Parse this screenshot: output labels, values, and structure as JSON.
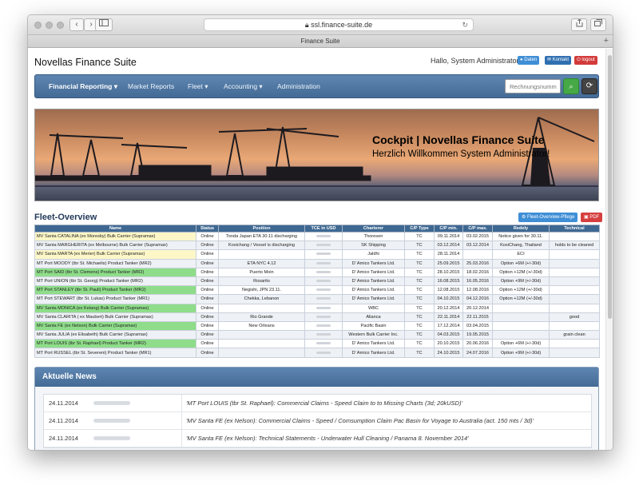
{
  "browser": {
    "url": "ssl.finance-suite.de",
    "tab_title": "Finance Suite",
    "back_label": "‹",
    "forward_label": "›",
    "reload_label": "↻",
    "new_tab_label": "+"
  },
  "header": {
    "brand": "Novellas Finance Suite",
    "greeting": "Hallo, System Administrator",
    "buttons": {
      "daten": "Daten",
      "kontakt": "Kontakt",
      "logout": "logout"
    }
  },
  "nav": {
    "items": [
      "Financial Reporting ▾",
      "Market Reports",
      "Fleet ▾",
      "Accounting ▾",
      "Administration"
    ],
    "search_placeholder": "Rechnungsnumm",
    "search_icon": "search-icon",
    "reset_icon": "refresh-icon"
  },
  "hero": {
    "title": "Cockpit | Novellas Finance Suite",
    "subtitle": "Herzlich Willkommen System Administrator!"
  },
  "fleet": {
    "title": "Fleet-Overview",
    "pflege_label": "Fleet-Overview-Pflege",
    "pdf_label": "PDF",
    "columns": [
      "Name",
      "Status",
      "Position",
      "TCE in USD",
      "Charterer",
      "C/P Type",
      "C/P min.",
      "C/P max.",
      "Redely",
      "Technical"
    ],
    "rows": [
      {
        "name": "MV Santa CATALINA (ex Moresby) Bulk Carrier (Supramax)",
        "status": "Online",
        "position": "Tonda Japan ETA 30.11 discharging",
        "charterer": "Thoresen",
        "type": "TC",
        "min": "09.11.2014",
        "max": "03.02.2015",
        "redely": "Notice given for 30.11.",
        "technical": "",
        "color": "yellow"
      },
      {
        "name": "MV Santa MARGHERITA (ex Melbourne) Bulk Carrier (Supramax)",
        "status": "Online",
        "position": "Kosichang / Vessel is discharging",
        "charterer": "SK Shipping",
        "type": "TC",
        "min": "03.12.2014",
        "max": "03.12.2014",
        "redely": "KosiChang, Thailand",
        "technical": "holds to be cleaned",
        "color": "yellow"
      },
      {
        "name": "MV Santa MARTA (ex Merier) Bulk Carrier (Supramax)",
        "status": "Online",
        "position": "",
        "charterer": "Jaldhi",
        "type": "TC",
        "min": "28.11.2014",
        "max": "",
        "redely": "ECI",
        "technical": "",
        "color": "yellow"
      },
      {
        "name": "MT Port MOODY (tbr St. Michaelis) Product Tanker (MR2)",
        "status": "Online",
        "position": "ETA NYC 4.12",
        "charterer": "D' Amico Tankers Ltd.",
        "type": "TC",
        "min": "25.09.2015",
        "max": "25.03.2016",
        "redely": "Option +6M (+/-30d)",
        "technical": "",
        "color": "green"
      },
      {
        "name": "MT Port SAID (tbr St. Clemens) Product Tanker (MR2)",
        "status": "Online",
        "position": "Puerto Moin",
        "charterer": "D' Amico Tankers Ltd.",
        "type": "TC",
        "min": "28.10.2015",
        "max": "18.02.2016",
        "redely": "Option +12M (+/-30d)",
        "technical": "",
        "color": "green"
      },
      {
        "name": "MT Port UNION (tbr St. Georg) Product Tanker (MR2)",
        "status": "Online",
        "position": "Rosarito",
        "charterer": "D' Amico Tankers Ltd.",
        "type": "TC",
        "min": "16.08.2015",
        "max": "16.05.2016",
        "redely": "Option +9M (+/-30d)",
        "technical": "",
        "color": "green"
      },
      {
        "name": "MT Port STANLEY (tbr St. Pauli) Product Tanker (MR2)",
        "status": "Online",
        "position": "Negishi, JPN 23.11.",
        "charterer": "D' Amico Tankers Ltd.",
        "type": "TC",
        "min": "12.08.2015",
        "max": "12.08.2016",
        "redely": "Option +12M (+/-30d)",
        "technical": "",
        "color": "green"
      },
      {
        "name": "MT Port STEWART (tbr St. Lukas) Product Tanker (MR1)",
        "status": "Online",
        "position": "Chekka, Lebanon",
        "charterer": "D' Amico Tankers Ltd.",
        "type": "TC",
        "min": "04.10.2015",
        "max": "04.12.2016",
        "redely": "Option +12M (+/-30d)",
        "technical": "",
        "color": "green"
      },
      {
        "name": "MV Santa MONICA (ex Kelang) Bulk Carrier (Supramax)",
        "status": "Online",
        "position": "",
        "charterer": "WBC",
        "type": "TC",
        "min": "20.12.2014",
        "max": "20.12.2014",
        "redely": "",
        "technical": "",
        "color": "green"
      },
      {
        "name": "MV Santa CLARITA ( ex Maubert) Bulk Carrier (Supramax)",
        "status": "Online",
        "position": "Rio Grande",
        "charterer": "Alianca",
        "type": "TC",
        "min": "22.11.2014",
        "max": "22.11.2015",
        "redely": "",
        "technical": "good",
        "color": "green"
      },
      {
        "name": "MV Santa FE (ex Nelson) Bulk Carrier (Supramax)",
        "status": "Online",
        "position": "New Orleans",
        "charterer": "Pacific Basin",
        "type": "TC",
        "min": "17.12.2014",
        "max": "03.04.2015",
        "redely": "",
        "technical": "",
        "color": "green"
      },
      {
        "name": "MV Santa JULIA (ex Elisabeth) Bulk Carrier (Supramax)",
        "status": "Online",
        "position": "",
        "charterer": "Western Bulk Carrier Inc.",
        "type": "TC",
        "min": "04.03.2015",
        "max": "19.05.2015",
        "redely": "",
        "technical": "grain clean",
        "color": "green"
      },
      {
        "name": "MT Port LOUIS (tbr St. Raphael) Product Tanker (MR2)",
        "status": "Online",
        "position": "",
        "charterer": "D' Amico Tankers Ltd.",
        "type": "TC",
        "min": "20.10.2015",
        "max": "20.06.2016",
        "redely": "Option +6M (+/-30d)",
        "technical": "",
        "color": "green"
      },
      {
        "name": "MT Port RUSSEL (tbr St. Severeni) Product Tanker (MR1)",
        "status": "Online",
        "position": "",
        "charterer": "D' Amico Tankers Ltd.",
        "type": "TC",
        "min": "24.10.2015",
        "max": "24.07.2016",
        "redely": "Option +9M (+/-30d)",
        "technical": "",
        "color": "green"
      }
    ]
  },
  "news": {
    "title": "Aktuelle News",
    "items": [
      {
        "date": "24.11.2014",
        "text": "'MT Port LOUIS (tbr St. Raphael): Commercial Claims - Speed Claim to to Missing Charts (3d; 20kUSD)'"
      },
      {
        "date": "24.11.2014",
        "text": "'MV Santa FE (ex Nelson): Commercial Claims - Speed / Comsumption Claim Pac Basin for Voyage to Australia (act. 150 mts / 3d)'"
      },
      {
        "date": "24.11.2014",
        "text": "'MV Santa FE (ex Nelson): Technical Statements - Underwater Hull Cleaning / Panama 8. November 2014'"
      }
    ]
  }
}
